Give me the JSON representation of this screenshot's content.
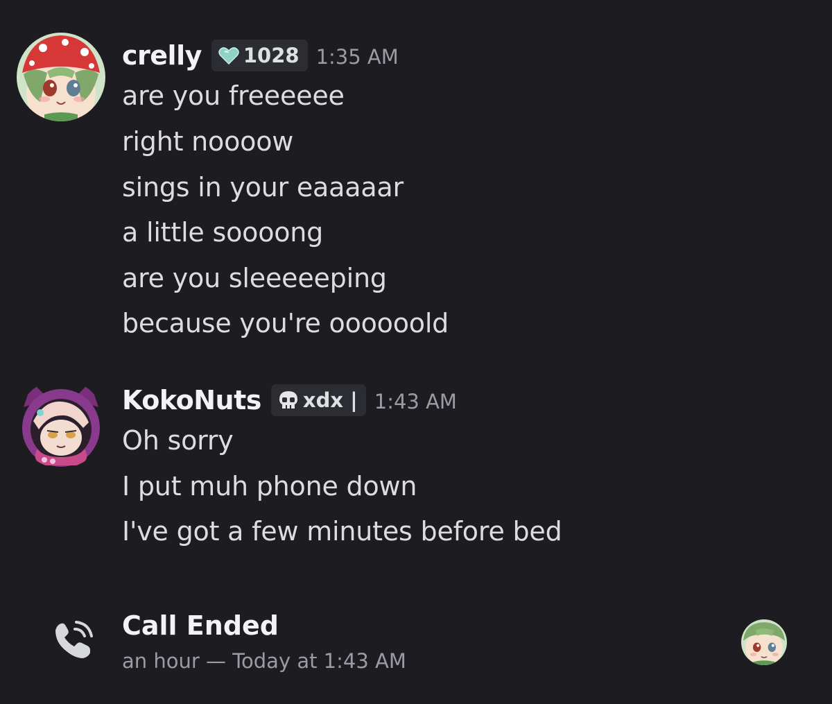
{
  "messages": [
    {
      "username": "crelly",
      "tag_icon": "heart-icon",
      "tag_text": "1028",
      "timestamp": "1:35 AM",
      "lines": [
        "are you freeeeee",
        "right noooow",
        "sings in your eaaaaar",
        "a little soooong",
        "are you sleeeeeping",
        "because you're oooooold"
      ]
    },
    {
      "username": "KokoNuts",
      "tag_icon": "skull-icon",
      "tag_text": "xdx |",
      "timestamp": "1:43 AM",
      "lines": [
        "Oh sorry",
        "I put muh phone down",
        "I've got a few minutes before bed"
      ]
    }
  ],
  "call": {
    "icon": "phone-call-icon",
    "title": "Call Ended",
    "subtitle": "an hour — Today at 1:43 AM"
  },
  "colors": {
    "background": "#1c1c21",
    "username": "#f2f3f5",
    "text": "#dcdde1",
    "muted": "#9a9ca5",
    "tag_bg": "#2b2d33"
  }
}
